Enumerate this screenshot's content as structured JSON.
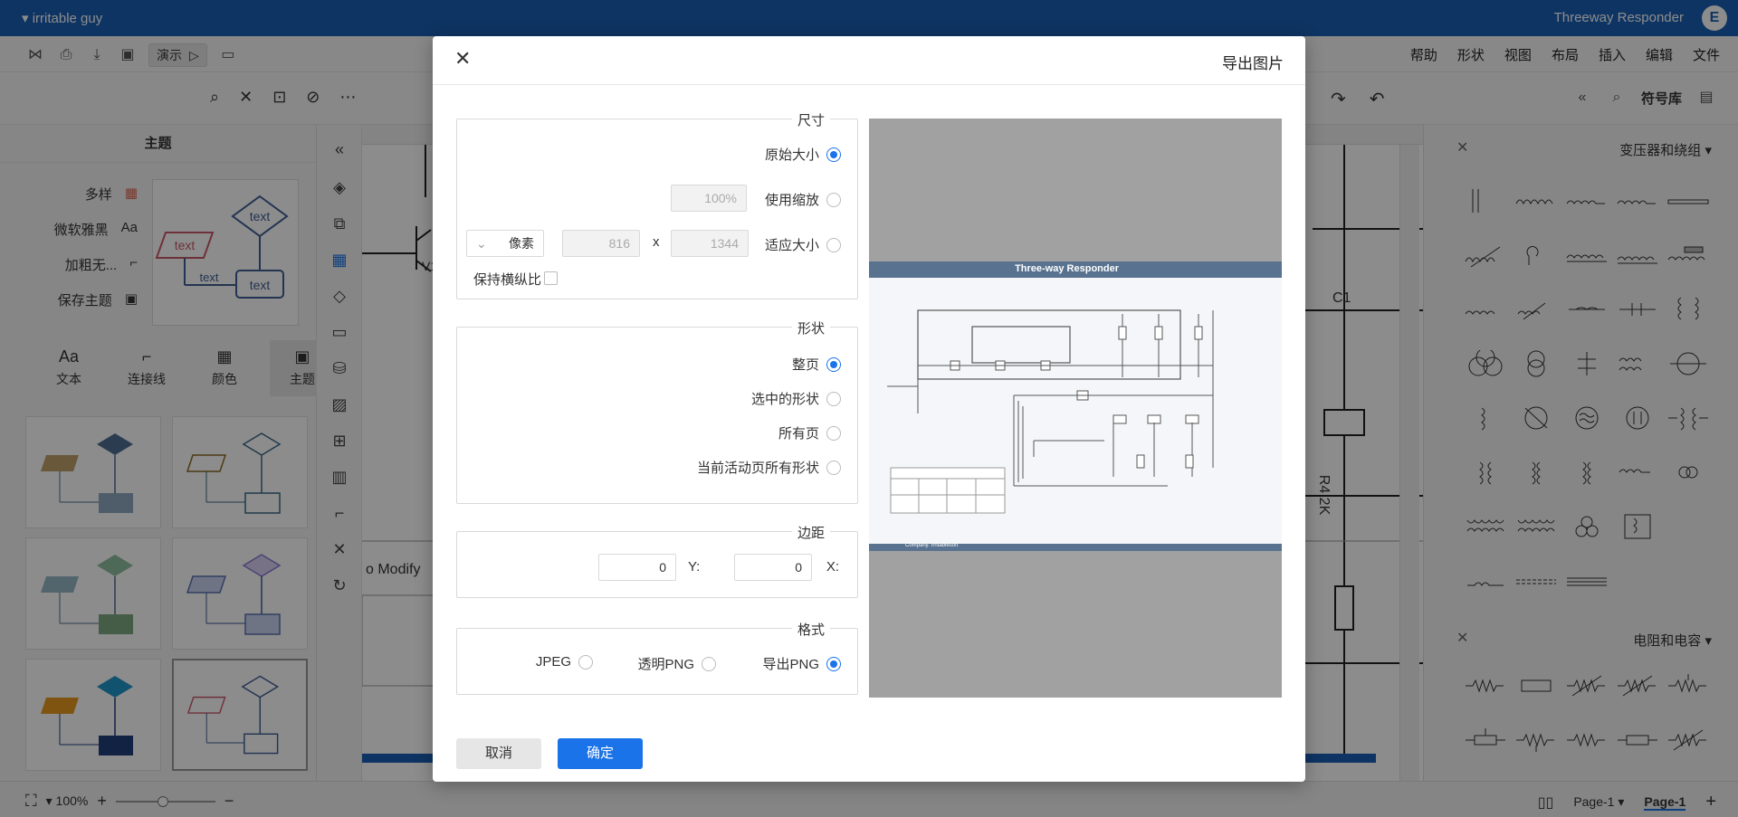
{
  "titlebar": {
    "doc_title": "Threeway Responder",
    "user_name": "irritable guy"
  },
  "menus": [
    "文件",
    "编辑",
    "插入",
    "布局",
    "视图",
    "形状",
    "帮助"
  ],
  "menubar": {
    "present_label": "演示"
  },
  "library": {
    "title": "符号库",
    "section1": "变压器和绕组",
    "section2": "电阻和电容"
  },
  "theme_panel": {
    "title": "主题",
    "actions": [
      "多样",
      "微软雅黑",
      "加粗无...",
      "保存主题"
    ],
    "tabs": [
      "主题",
      "颜色",
      "连接线",
      "文本"
    ],
    "preview_labels": [
      "text",
      "text",
      "text"
    ]
  },
  "canvas": {
    "label_c1": "C1",
    "label_r4": "R4 2K",
    "label_modify": "o Modify",
    "label_v1": "V1"
  },
  "statusbar": {
    "zoom": "100%",
    "page_selector": "Page-1",
    "page_tab": "Page-1"
  },
  "dialog": {
    "title": "导出图片",
    "size_group": {
      "legend": "尺寸",
      "opt_original": "原始大小",
      "opt_scale": "使用缩放",
      "scale_value": "100%",
      "opt_fit": "适应大小",
      "width_value": "1344",
      "times": "x",
      "height_value": "816",
      "unit": "像素",
      "keep_ratio": "保持横纵比"
    },
    "shape_group": {
      "legend": "形状",
      "opt_whole": "整页",
      "opt_selected": "选中的形状",
      "opt_all": "所有页",
      "opt_current": "当前活动页所有形状"
    },
    "margin_group": {
      "legend": "边距",
      "x_label": "X:",
      "x_value": "0",
      "y_label": "Y:",
      "y_value": "0"
    },
    "format_group": {
      "legend": "格式",
      "opt_png": "导出PNG",
      "opt_transparent": "透明PNG",
      "opt_jpeg": "JPEG"
    },
    "confirm": "确定",
    "cancel": "取消",
    "preview_header": "Three-way Responder",
    "preview_footer": "Company: irritablesoft"
  },
  "colors": {
    "accent": "#1a73e8",
    "titlebar": "#1a5fb4",
    "preview_band": "#58728f"
  }
}
